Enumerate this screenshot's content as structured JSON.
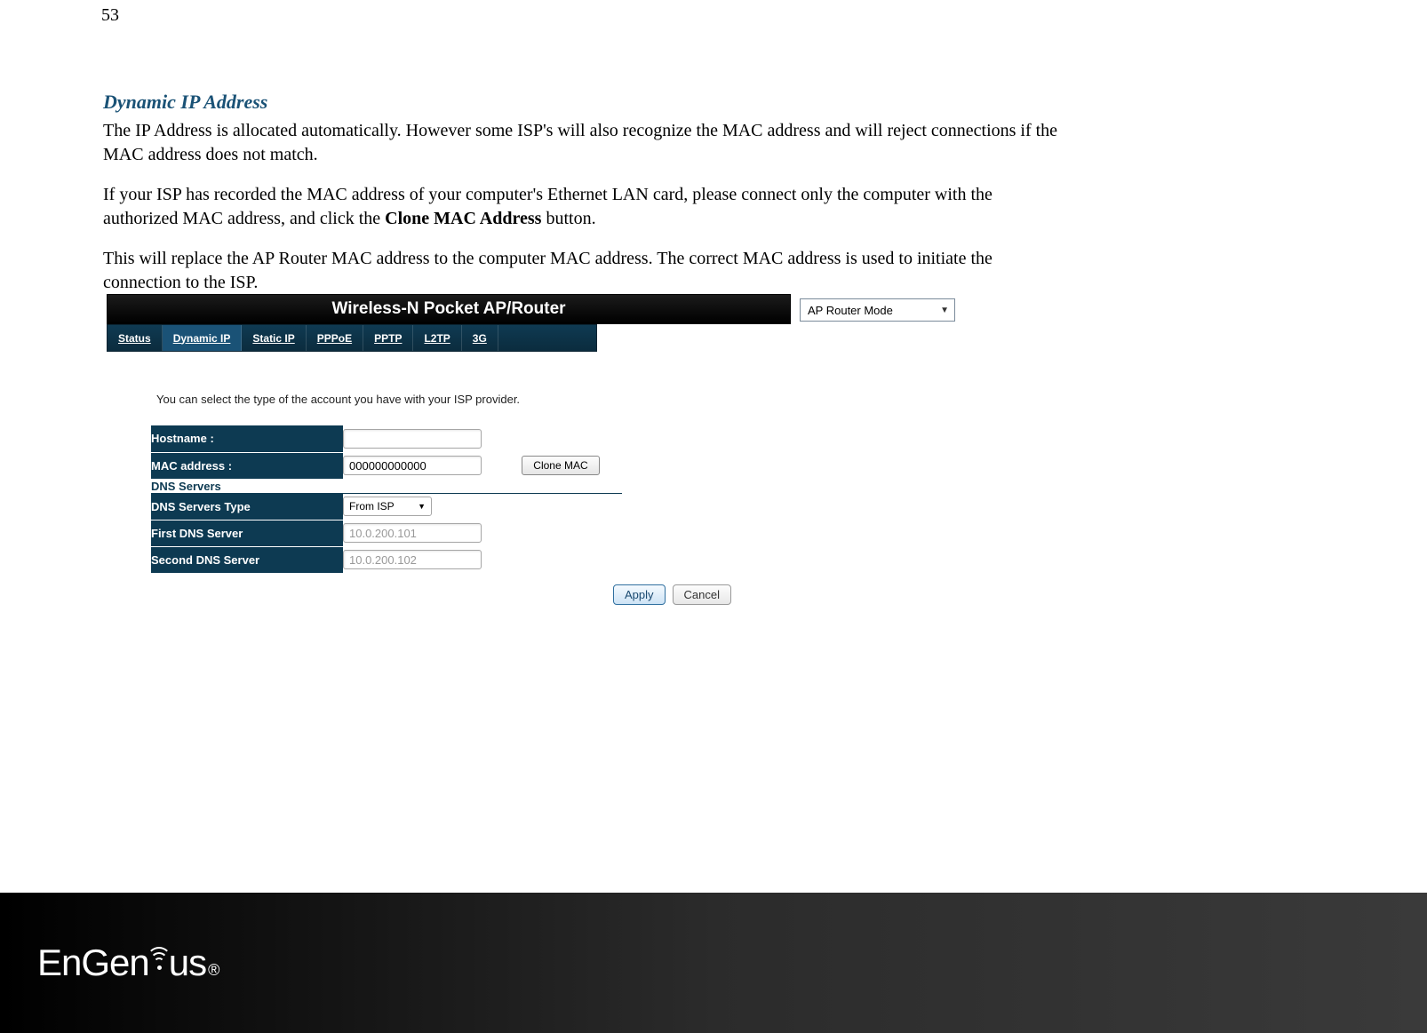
{
  "page_number": "53",
  "section_title": "Dynamic IP Address",
  "para1": "The IP Address is allocated automatically. However some ISP's will also recognize the MAC address and will reject connections if the MAC address does not match.",
  "para2_pre": "If your ISP has recorded the MAC address of your computer's Ethernet LAN card, please connect only the computer with the authorized MAC address, and click the ",
  "para2_bold": "Clone MAC Address",
  "para2_post": " button.",
  "para3": "This will replace the AP Router MAC address to the computer MAC address. The correct MAC address is used to initiate the connection to the ISP.",
  "router": {
    "title": "Wireless-N Pocket AP/Router",
    "mode": "AP Router Mode",
    "tabs": [
      "Status",
      "Dynamic IP",
      "Static IP",
      "PPPoE",
      "PPTP",
      "L2TP",
      "3G"
    ],
    "instruction": "You can select the type of the account you have with your ISP provider.",
    "fields": {
      "hostname_label": "Hostname :",
      "hostname_value": "",
      "mac_label": "MAC address :",
      "mac_value": "000000000000",
      "clone_btn": "Clone MAC",
      "dns_section": "DNS Servers",
      "dns_type_label": "DNS Servers Type",
      "dns_type_value": "From ISP",
      "dns1_label": "First DNS Server",
      "dns1_value": "10.0.200.101",
      "dns2_label": "Second DNS Server",
      "dns2_value": "10.0.200.102"
    },
    "apply": "Apply",
    "cancel": "Cancel"
  },
  "brand": {
    "part1": "En",
    "part2": "Gen",
    "part3": "us",
    "reg": "®"
  }
}
